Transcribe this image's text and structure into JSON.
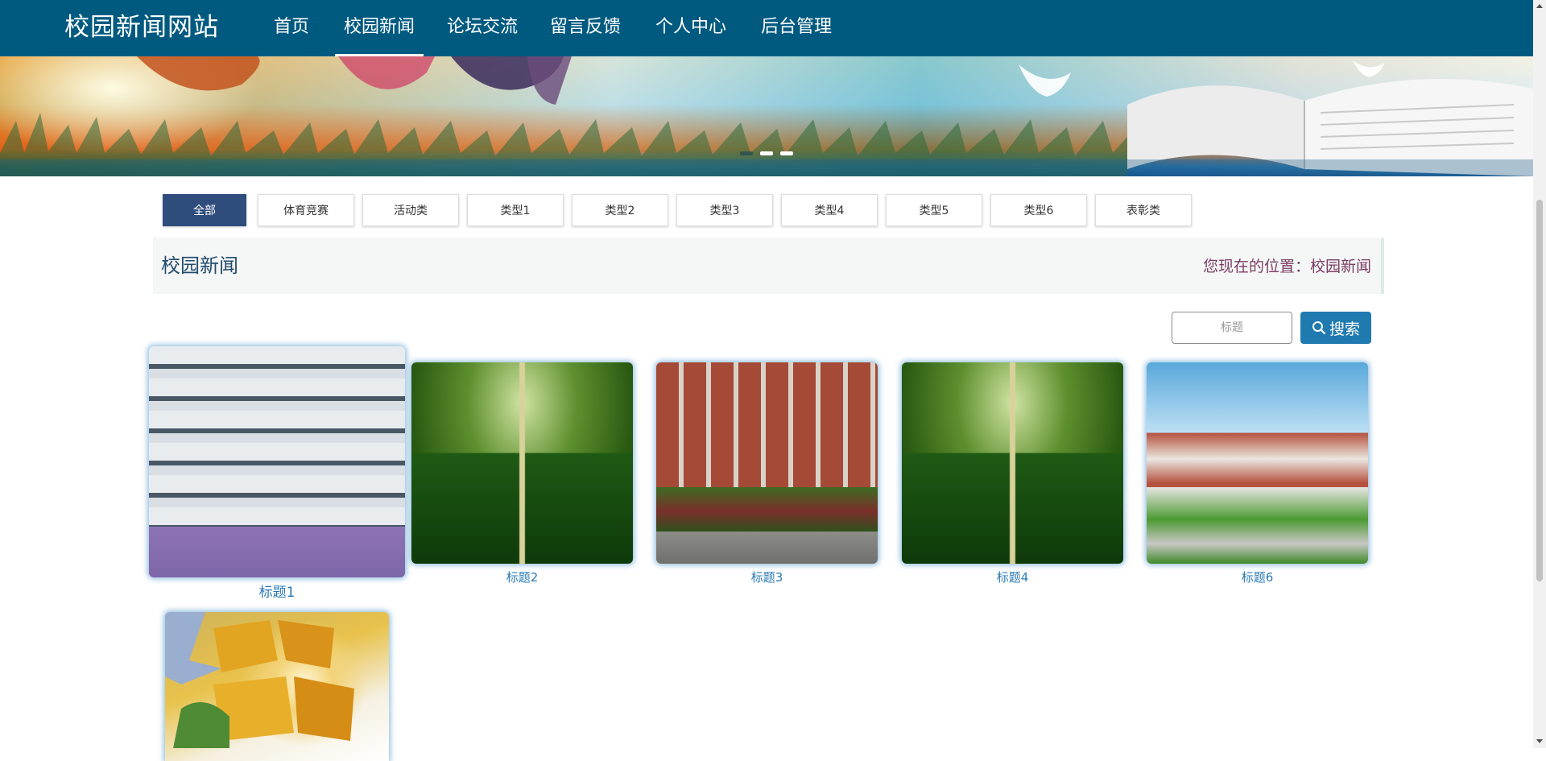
{
  "site": {
    "brand": "校园新闻网站"
  },
  "nav": {
    "items": [
      {
        "label": "首页"
      },
      {
        "label": "校园新闻",
        "active": true
      },
      {
        "label": "论坛交流"
      },
      {
        "label": "留言反馈"
      },
      {
        "label": "个人中心"
      },
      {
        "label": "后台管理"
      }
    ]
  },
  "banner": {
    "slide_count": 3,
    "active_slide": 1
  },
  "categories": [
    {
      "label": "全部",
      "active": true
    },
    {
      "label": "体育竞赛"
    },
    {
      "label": "活动类"
    },
    {
      "label": "类型1"
    },
    {
      "label": "类型2"
    },
    {
      "label": "类型3"
    },
    {
      "label": "类型4"
    },
    {
      "label": "类型5"
    },
    {
      "label": "类型6"
    },
    {
      "label": "表彰类"
    }
  ],
  "section": {
    "title": "校园新闻",
    "breadcrumb_prefix": "您现在的位置：",
    "breadcrumb_current": "校园新闻"
  },
  "search": {
    "placeholder": "标题",
    "value": "",
    "button_label": "搜索",
    "icon": "search-icon"
  },
  "news": [
    {
      "title": "标题1",
      "photo": "modern-campus-building",
      "featured": true
    },
    {
      "title": "标题2",
      "photo": "tree-lined-avenue"
    },
    {
      "title": "标题3",
      "photo": "brick-campus-building"
    },
    {
      "title": "标题4",
      "photo": "tree-lined-avenue"
    },
    {
      "title": "标题6",
      "photo": "curved-campus-building"
    },
    {
      "title": "",
      "photo": "campus-sign-sculpture"
    }
  ],
  "colors": {
    "header": "#005a80",
    "active_category": "#2e4d7c",
    "search_button": "#1f7ab0",
    "caption": "#2a7ab5",
    "breadcrumb": "#7a3d63"
  }
}
